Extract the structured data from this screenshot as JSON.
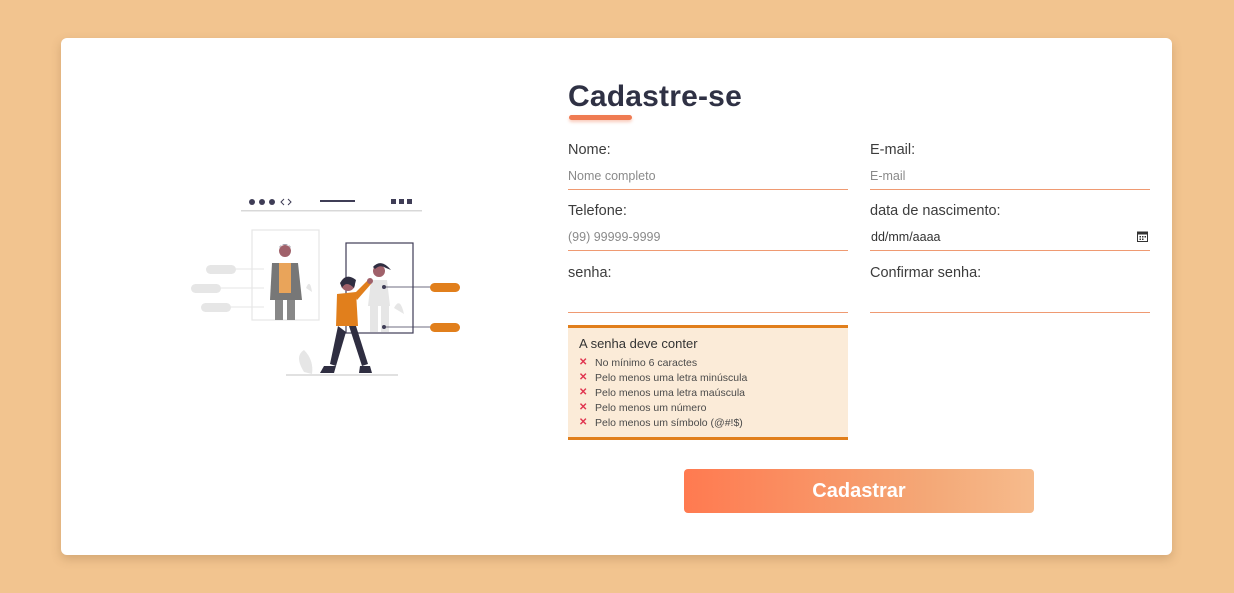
{
  "form": {
    "title": "Cadastre-se",
    "fields": {
      "nome": {
        "label": "Nome:",
        "placeholder": "Nome completo",
        "value": ""
      },
      "email": {
        "label": "E-mail:",
        "placeholder": "E-mail",
        "value": ""
      },
      "telefone": {
        "label": "Telefone:",
        "placeholder": "(99) 99999-9999",
        "value": ""
      },
      "nascimento": {
        "label": "data de nascimento:",
        "display": "dd/mm/aaaa"
      },
      "senha": {
        "label": "senha:",
        "placeholder": "",
        "value": ""
      },
      "confirmar": {
        "label": "Confirmar senha:",
        "placeholder": "",
        "value": ""
      }
    },
    "password_rules": {
      "title": "A senha deve conter",
      "items": [
        {
          "mark": "✕",
          "text": "No mínimo 6 caractes"
        },
        {
          "mark": "✕",
          "text": "Pelo menos uma letra minúscula"
        },
        {
          "mark": "✕",
          "text": "Pelo menos uma letra maúscula"
        },
        {
          "mark": "✕",
          "text": "Pelo menos um número"
        },
        {
          "mark": "✕",
          "text": "Pelo menos um símbolo (@#!$)"
        }
      ]
    },
    "submit_label": "Cadastrar"
  },
  "colors": {
    "background": "#f2c48f",
    "accent": "#ef7b52",
    "rules_border": "#e17f1c",
    "error_mark": "#e0334e",
    "illustration_orange": "#e17f1c"
  },
  "icons": {
    "date_picker": "calendar-icon",
    "rule_mark": "x-mark-icon"
  }
}
